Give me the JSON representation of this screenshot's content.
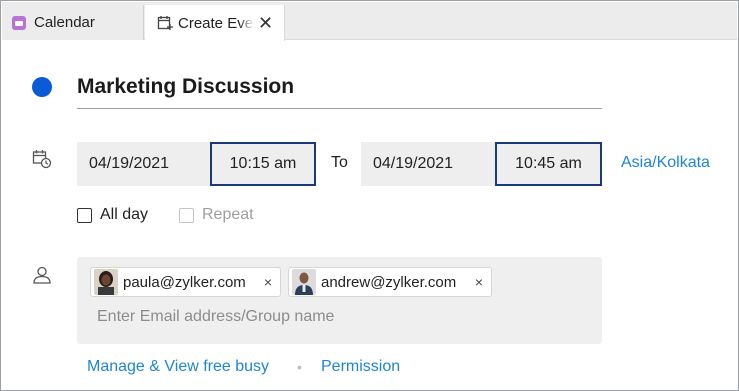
{
  "tabs": [
    {
      "label": "Calendar",
      "icon": "calendar-icon"
    },
    {
      "label": "Create Event",
      "icon": "create-event-icon",
      "close_icon": "close-icon",
      "close_glyph": "✕"
    }
  ],
  "event": {
    "title": "Marketing Discussion",
    "color": "#0a5bd6"
  },
  "datetime": {
    "start_date": "04/19/2021",
    "start_time": "10:15 am",
    "to_label": "To",
    "end_date": "04/19/2021",
    "end_time": "10:45 am",
    "timezone": "Asia/Kolkata"
  },
  "options": {
    "all_day_label": "All day",
    "all_day_checked": false,
    "repeat_label": "Repeat",
    "repeat_enabled": false
  },
  "attendees": {
    "chips": [
      {
        "email": "paula@zylker.com",
        "remove": "×"
      },
      {
        "email": "andrew@zylker.com",
        "remove": "×"
      }
    ],
    "placeholder": "Enter Email address/Group name"
  },
  "links": {
    "manage": "Manage & View free busy",
    "separator": "•",
    "permission": "Permission"
  },
  "colors": {
    "accent_link": "#1d85d6",
    "focus_border": "#1b3a7a"
  }
}
